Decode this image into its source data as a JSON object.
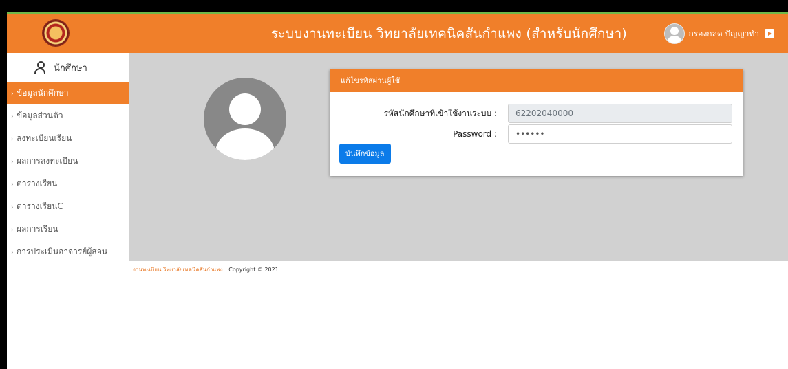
{
  "header": {
    "app_title": "ระบบงานทะเบียน วิทยาลัยเทคนิคสันกำแพง (สำหรับนักศึกษา)",
    "user_name": "กรองกลด ปัญญาทำ",
    "logo_icon": "college-seal-logo",
    "logout_icon": "logout-icon"
  },
  "sidebar": {
    "title": "นักศึกษา",
    "items": [
      {
        "label": "ข้อมูลนักศึกษา",
        "active": true
      },
      {
        "label": "ข้อมูลส่วนตัว",
        "active": false
      },
      {
        "label": "ลงทะเบียนเรียน",
        "active": false
      },
      {
        "label": "ผลการลงทะเบียน",
        "active": false
      },
      {
        "label": "ตารางเรียน",
        "active": false
      },
      {
        "label": "ตารางเรียนC",
        "active": false
      },
      {
        "label": "ผลการเรียน",
        "active": false
      },
      {
        "label": "การประเมินอาจารย์ผู้สอน",
        "active": false
      }
    ]
  },
  "card": {
    "title": "แก้ไขรหัสผ่านผู้ใช้",
    "username_label": "รหัสนักศึกษาที่เข้าใช้งานระบบ :",
    "username_value": "62202040000",
    "password_label": "Password :",
    "password_value": "••••••",
    "save_label": "บันทึกข้อมูล"
  },
  "footer": {
    "org": "งานทะเบียน วิทยาลัยเทคนิคสันกำแพง",
    "copyright": "Copyright © 2021"
  },
  "colors": {
    "accent": "#f07f2a",
    "button": "#0b7be9",
    "content_bg": "#d1d1d1"
  }
}
